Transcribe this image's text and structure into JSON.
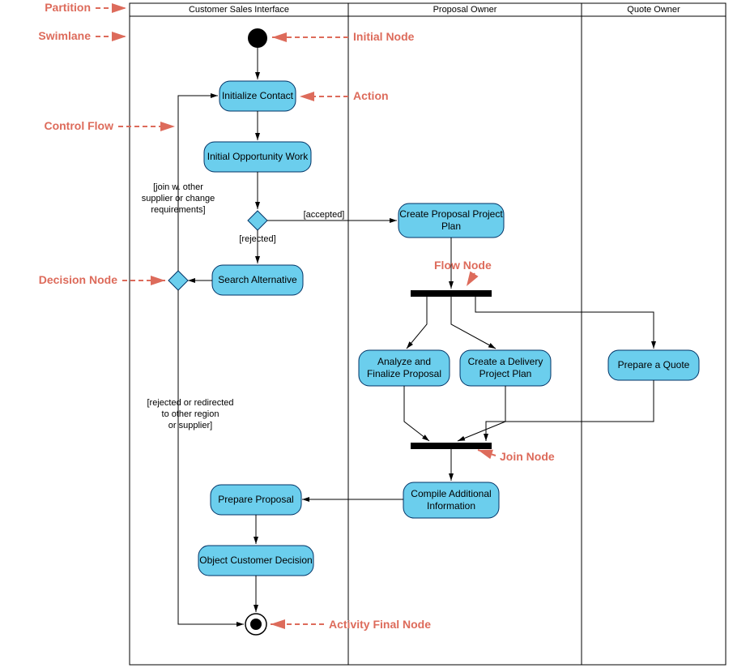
{
  "swimlanes": {
    "header1": "Customer Sales Interface",
    "header2": "Proposal Owner",
    "header3": "Quote Owner"
  },
  "actions": {
    "initialize_contact": "Initialize Contact",
    "initial_opportunity": "Initial Opportunity Work",
    "search_alternative": "Search Alternative",
    "create_proposal_plan": "Create Proposal Project Plan",
    "analyze_finalize_1": "Analyze and",
    "analyze_finalize_2": "Finalize Proposal",
    "create_delivery_1": "Create a Delivery",
    "create_delivery_2": "Project Plan",
    "prepare_quote": "Prepare a Quote",
    "compile_additional_1": "Compile Additional",
    "compile_additional_2": "Information",
    "prepare_proposal": "Prepare Proposal",
    "object_decision": "Object Customer Decision"
  },
  "guards": {
    "join_change_1": "[join w. other",
    "join_change_2": "supplier or change",
    "join_change_3": "requirements]",
    "accepted": "[accepted]",
    "rejected": "[rejected]",
    "rejected_redirect_1": "[rejected or redirected",
    "rejected_redirect_2": "to other region",
    "rejected_redirect_3": "or supplier]"
  },
  "annotations": {
    "partition": "Partition",
    "swimlane": "Swimlane",
    "control_flow": "Control Flow",
    "decision_node": "Decision Node",
    "initial_node": "Initial Node",
    "action": "Action",
    "flow_node": "Flow Node",
    "join_node": "Join Node",
    "activity_final": "Activity Final Node"
  }
}
